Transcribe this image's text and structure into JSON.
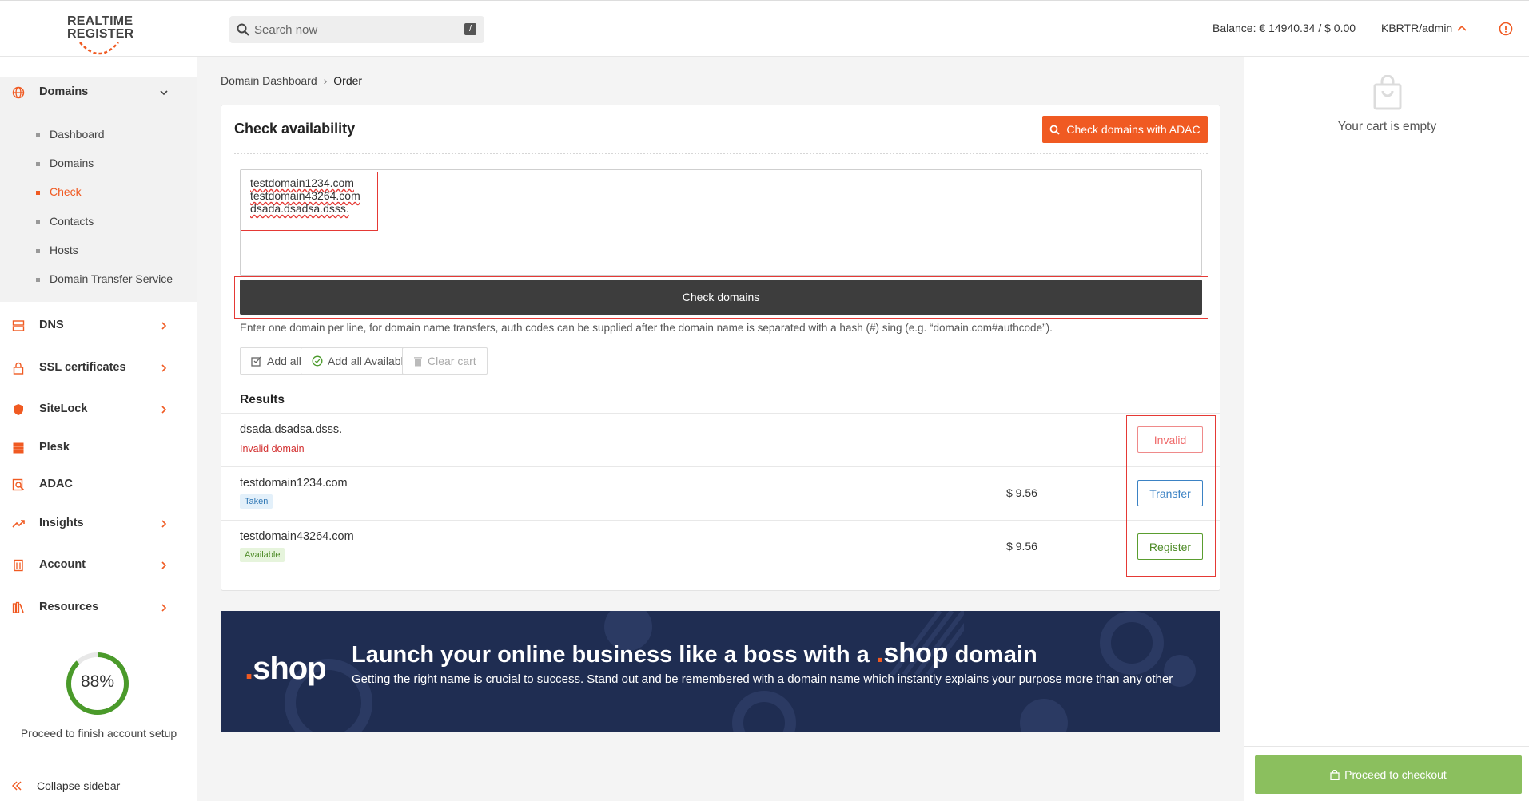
{
  "header": {
    "logo_line1": "REALTIME",
    "logo_line2": "REGISTER",
    "search_placeholder": "Search now",
    "search_shortcut": "/",
    "balance": "Balance: € 14940.34 / $ 0.00",
    "user": "KBRTR/admin"
  },
  "sidebar": {
    "domains_label": "Domains",
    "sub_items": [
      "Dashboard",
      "Domains",
      "Check",
      "Contacts",
      "Hosts",
      "Domain Transfer Service"
    ],
    "active_sub_item": "Check",
    "items": [
      {
        "label": "DNS",
        "icon": "server-icon",
        "has_chevron": true
      },
      {
        "label": "SSL certificates",
        "icon": "lock-icon",
        "has_chevron": true
      },
      {
        "label": "SiteLock",
        "icon": "shield-icon",
        "has_chevron": true
      },
      {
        "label": "Plesk",
        "icon": "stack-icon",
        "has_chevron": false
      },
      {
        "label": "ADAC",
        "icon": "adac-icon",
        "has_chevron": false
      },
      {
        "label": "Insights",
        "icon": "trend-icon",
        "has_chevron": true
      },
      {
        "label": "Account",
        "icon": "building-icon",
        "has_chevron": true
      },
      {
        "label": "Resources",
        "icon": "books-icon",
        "has_chevron": true
      }
    ],
    "progress_value": 0.88,
    "progress_label": "88%",
    "progress_caption": "Proceed to finish account setup",
    "collapse_label": "Collapse sidebar"
  },
  "breadcrumb": {
    "parent": "Domain Dashboard",
    "separator": "›",
    "current": "Order"
  },
  "check": {
    "title": "Check availability",
    "adac_button": "Check domains with ADAC",
    "domains_input": [
      "testdomain1234.com",
      "testdomain43264.com",
      "dsada.dsadsa.dsss."
    ],
    "check_button": "Check domains",
    "hint": "Enter one domain per line, for domain name transfers, auth codes can be supplied after the domain name is separated with a hash (#) sing (e.g. “domain.com#authcode”).",
    "add_all": "Add all",
    "add_all_available": "Add all Available",
    "clear_cart": "Clear cart",
    "results_title": "Results",
    "results": [
      {
        "domain": "dsada.dsadsa.dsss.",
        "status": "Invalid domain",
        "price": "",
        "action": "Invalid"
      },
      {
        "domain": "testdomain1234.com",
        "status": "Taken",
        "price": "$ 9.56",
        "action": "Transfer"
      },
      {
        "domain": "testdomain43264.com",
        "status": "Available",
        "price": "$ 9.56",
        "action": "Register"
      }
    ]
  },
  "banner": {
    "logo_dot": ".",
    "logo_word": "shop",
    "title_pre": "Launch your online business like a boss with a ",
    "title_dot": ".",
    "title_brand": "shop",
    "title_post": " domain",
    "text": "Getting the right name is crucial to success. Stand out and be remembered with a domain name which instantly explains your purpose more than any other"
  },
  "cart": {
    "empty_text": "Your cart is empty",
    "checkout_button": "Proceed to checkout"
  },
  "colors": {
    "accent": "#f05a22",
    "dark_button": "#3d3d3d",
    "banner_bg": "#1f2d52",
    "checkout_green": "#8bbf5e",
    "highlight_red": "#e53935"
  }
}
